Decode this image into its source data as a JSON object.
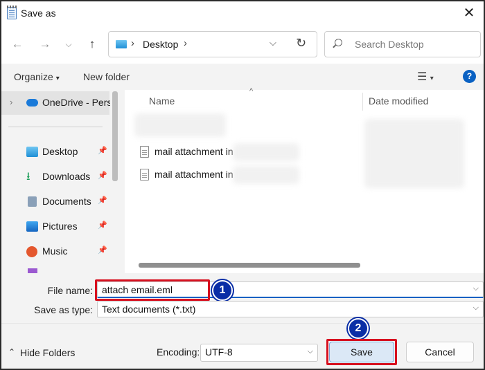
{
  "window": {
    "title": "Save as"
  },
  "address": {
    "location": "Desktop"
  },
  "search": {
    "placeholder": "Search Desktop"
  },
  "toolbar": {
    "organize_label": "Organize",
    "new_folder_label": "New folder"
  },
  "nav_pane": {
    "items": [
      {
        "label": "OneDrive - Perso",
        "pinned": false,
        "icon": "cloud-icon"
      },
      {
        "label": "Desktop",
        "pinned": true,
        "icon": "desktop-folder-icon"
      },
      {
        "label": "Downloads",
        "pinned": true,
        "icon": "download-icon"
      },
      {
        "label": "Documents",
        "pinned": true,
        "icon": "documents-icon"
      },
      {
        "label": "Pictures",
        "pinned": true,
        "icon": "pictures-icon"
      },
      {
        "label": "Music",
        "pinned": true,
        "icon": "music-icon"
      }
    ]
  },
  "file_list": {
    "columns": {
      "name": "Name",
      "date": "Date modified"
    },
    "files": [
      {
        "name": "mail attachment in"
      },
      {
        "name": "mail attachment in"
      }
    ]
  },
  "fields": {
    "file_name_label": "File name:",
    "file_name_value": "attach email.eml",
    "save_type_label": "Save as type:",
    "save_type_value": "Text documents (*.txt)"
  },
  "footer": {
    "hide_folders_label": "Hide Folders",
    "encoding_label": "Encoding:",
    "encoding_value": "UTF-8",
    "save_label": "Save",
    "cancel_label": "Cancel"
  },
  "annotations": {
    "step1": "1",
    "step2": "2"
  },
  "colors": {
    "accent": "#0a61c3",
    "highlight_red": "#d7101f",
    "badge_blue": "#0a2ea6"
  }
}
